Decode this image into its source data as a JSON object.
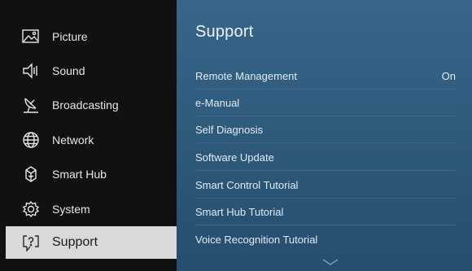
{
  "menu": {
    "items": [
      {
        "label": "Picture",
        "icon": "picture-icon"
      },
      {
        "label": "Sound",
        "icon": "sound-icon"
      },
      {
        "label": "Broadcasting",
        "icon": "broadcasting-icon"
      },
      {
        "label": "Network",
        "icon": "network-icon"
      },
      {
        "label": "Smart Hub",
        "icon": "smart-hub-icon"
      },
      {
        "label": "System",
        "icon": "system-icon"
      },
      {
        "label": "Support",
        "icon": "support-icon",
        "selected": true
      }
    ]
  },
  "panel": {
    "title": "Support",
    "options": [
      {
        "label": "Remote Management",
        "value": "On"
      },
      {
        "label": "e-Manual"
      },
      {
        "label": "Self Diagnosis"
      },
      {
        "label": "Software Update"
      },
      {
        "label": "Smart Control Tutorial"
      },
      {
        "label": "Smart Hub Tutorial"
      },
      {
        "label": "Voice Recognition Tutorial"
      }
    ],
    "more_indicator": "chevron-down-icon"
  },
  "colors": {
    "menu_bg": "#111111",
    "selected_bg": "#d9d9d9",
    "panel_bg": "#2f5b7d",
    "text_light": "#e6e6e6"
  }
}
